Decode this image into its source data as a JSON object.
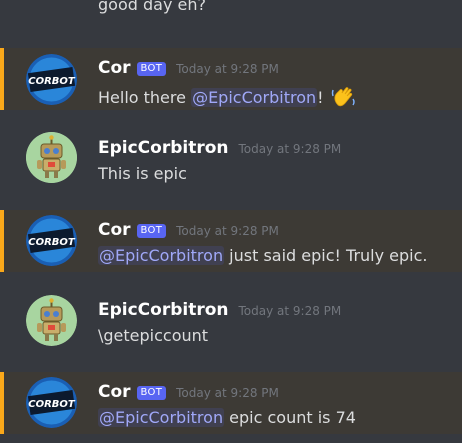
{
  "fragment_text": "good day eh?",
  "colors": {
    "background": "#36393f",
    "mention_highlight": "#3d3a35",
    "mention_border": "#faa81a",
    "bot_tag": "#5865f2",
    "user_mention": "#a0a8f8"
  },
  "messages": [
    {
      "author": "Cor",
      "bot_tag": "BOT",
      "timestamp": "Today at 9:28 PM",
      "avatar_text": "CORBOT",
      "mention": "@EpicCorbitron",
      "text_before": "Hello there ",
      "text_after": "!",
      "emoji": "wave-emoji"
    },
    {
      "author": "EpicCorbitron",
      "timestamp": "Today at 9:28 PM",
      "text": "This is epic"
    },
    {
      "author": "Cor",
      "bot_tag": "BOT",
      "timestamp": "Today at 9:28 PM",
      "avatar_text": "CORBOT",
      "mention": "@EpicCorbitron",
      "text_after": " just said epic! Truly epic."
    },
    {
      "author": "EpicCorbitron",
      "timestamp": "Today at 9:28 PM",
      "text": "\\getepiccount"
    },
    {
      "author": "Cor",
      "bot_tag": "BOT",
      "timestamp": "Today at 9:28 PM",
      "avatar_text": "CORBOT",
      "mention": "@EpicCorbitron",
      "text_after": " epic count is 74"
    }
  ]
}
